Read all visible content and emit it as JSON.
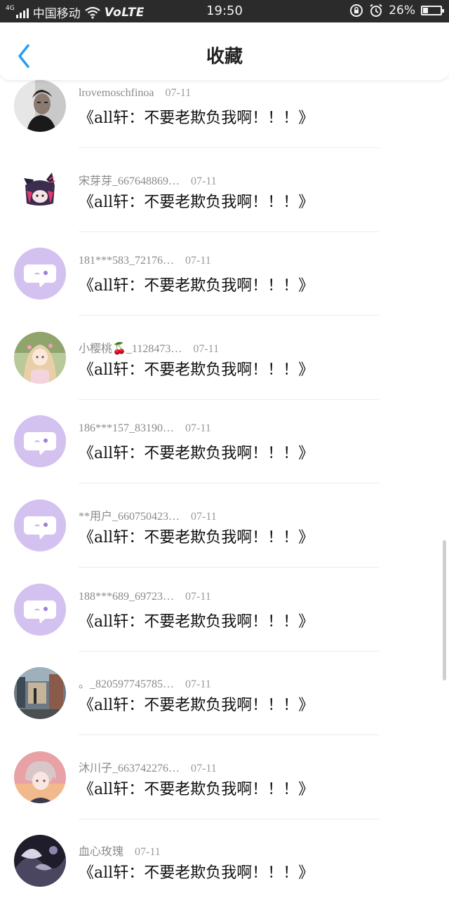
{
  "status_bar": {
    "network": "4G",
    "carrier": "中国移动",
    "volte": "VoLTE",
    "time": "19:50",
    "battery": "26%",
    "battery_level": 0.26
  },
  "header": {
    "title": "收藏",
    "back_icon": "chevron-left-icon",
    "accent_color": "#2a9df4"
  },
  "items": [
    {
      "name": "lrovemoschfinoa",
      "date": "07-11",
      "text": "《all轩：不要老欺负我啊！！！》",
      "avatar": "photo-man"
    },
    {
      "name": "宋芽芽_667648869…",
      "date": "07-11",
      "text": "《all轩：不要老欺负我啊！！！》",
      "avatar": "anime-chibi"
    },
    {
      "name": "181***583_72176…",
      "date": "07-11",
      "text": "《all轩：不要老欺负我啊！！！》",
      "avatar": "default"
    },
    {
      "name": "小樱桃🍒_1128473…",
      "date": "07-11",
      "text": "《all轩：不要老欺负我啊！！！》",
      "avatar": "anime-girl"
    },
    {
      "name": "186***157_83190…",
      "date": "07-11",
      "text": "《all轩：不要老欺负我啊！！！》",
      "avatar": "default"
    },
    {
      "name": "**用户_660750423…",
      "date": "07-11",
      "text": "《all轩：不要老欺负我啊！！！》",
      "avatar": "default"
    },
    {
      "name": "188***689_69723…",
      "date": "07-11",
      "text": "《all轩：不要老欺负我啊！！！》",
      "avatar": "default"
    },
    {
      "name": "。_820597745785…",
      "date": "07-11",
      "text": "《all轩：不要老欺负我啊！！！》",
      "avatar": "photo-street"
    },
    {
      "name": "沐川子_663742276…",
      "date": "07-11",
      "text": "《all轩：不要老欺负我啊！！！》",
      "avatar": "anime-boy"
    },
    {
      "name": "血心玫瑰",
      "date": "07-11",
      "text": "《all轩：不要老欺负我啊！！！》",
      "avatar": "dark-art"
    }
  ]
}
